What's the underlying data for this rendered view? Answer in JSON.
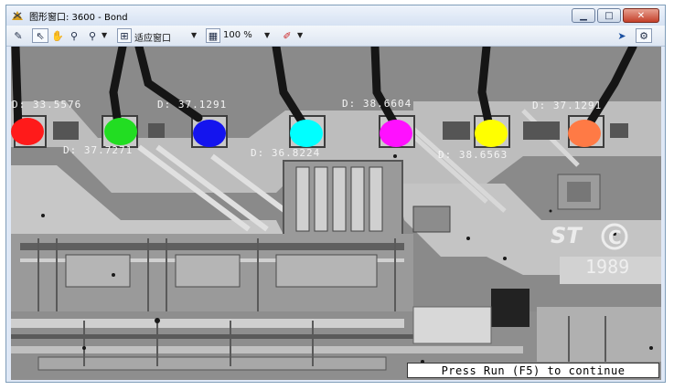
{
  "window": {
    "title": "图形窗口: 3600 - Bond"
  },
  "toolbar": {
    "fit_window_label": "适应窗口",
    "zoom_value": "100 %"
  },
  "measurements": [
    {
      "label": "D: 33.5576",
      "color": "#ff1a1a"
    },
    {
      "label": "D: 37.7271",
      "color": "#22dd22"
    },
    {
      "label": "D: 37.1291",
      "color": "#1414ee"
    },
    {
      "label": "D: 36.8224",
      "color": "#00ffff"
    },
    {
      "label": "D: 38.6604",
      "color": "#ff10ff"
    },
    {
      "label": "D: 38.6563",
      "color": "#ffff00"
    },
    {
      "label": "D: 37.1291",
      "color": "#ff7a45"
    }
  ],
  "chip_marking": {
    "logo": "ST",
    "letter": "C",
    "year": "1989"
  },
  "status": {
    "message": "Press Run (F5) to continue"
  }
}
